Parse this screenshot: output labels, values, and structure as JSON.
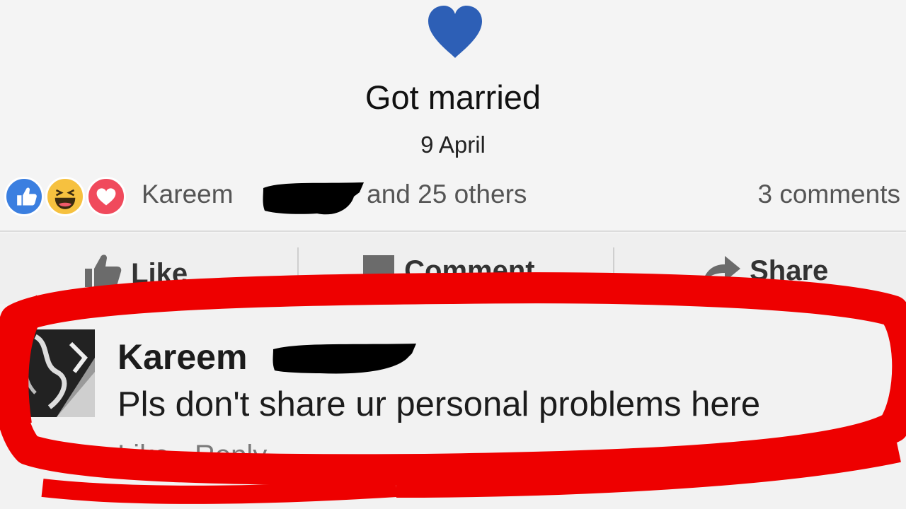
{
  "event": {
    "icon": "heart-icon",
    "icon_color": "#2d5fb6",
    "title": "Got married",
    "date": "9 April"
  },
  "reactions": {
    "icons": [
      "like-reaction-icon",
      "haha-reaction-icon",
      "love-reaction-icon"
    ],
    "likers_name": "Kareem",
    "likers_suffix": "and 25 others",
    "comment_count": "3 comments"
  },
  "actions": {
    "like": "Like",
    "comment": "Comment",
    "share": "Share"
  },
  "comment": {
    "author": "Kareem",
    "text": "Pls don't share ur personal problems here",
    "like_label": "Like",
    "separator": "·",
    "reply_label": "Reply"
  },
  "colors": {
    "marker": "#ee0000",
    "redaction": "#000000"
  }
}
